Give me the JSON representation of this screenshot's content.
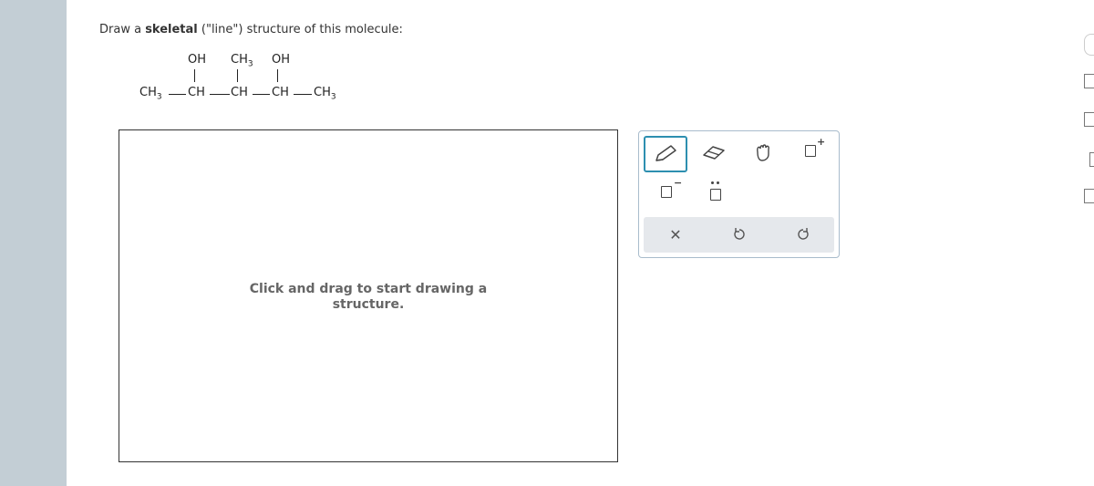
{
  "prompt": {
    "prefix": "Draw a ",
    "bold": "skeletal",
    "suffix": " (\"line\") structure of this molecule:"
  },
  "molecule": {
    "top_labels": [
      "OH",
      "CH",
      "OH"
    ],
    "top_sub": "3",
    "main_labels": [
      "CH",
      "CH",
      "CH",
      "CH",
      "CH"
    ],
    "main_sub": "3"
  },
  "canvas": {
    "hint": "Click and drag to start drawing a structure."
  },
  "toolbar": {
    "tools": [
      "pencil-icon",
      "eraser-icon",
      "hand-icon",
      "add-charge-icon",
      "negative-charge-icon",
      "lone-pair-icon"
    ],
    "actions": [
      "clear-icon",
      "undo-icon",
      "redo-icon"
    ]
  },
  "colors": {
    "rail": "#c3ced5",
    "accent": "#2d8fb0",
    "toolbar_border": "#a9bccc",
    "action_bg": "#e5e8ec"
  }
}
